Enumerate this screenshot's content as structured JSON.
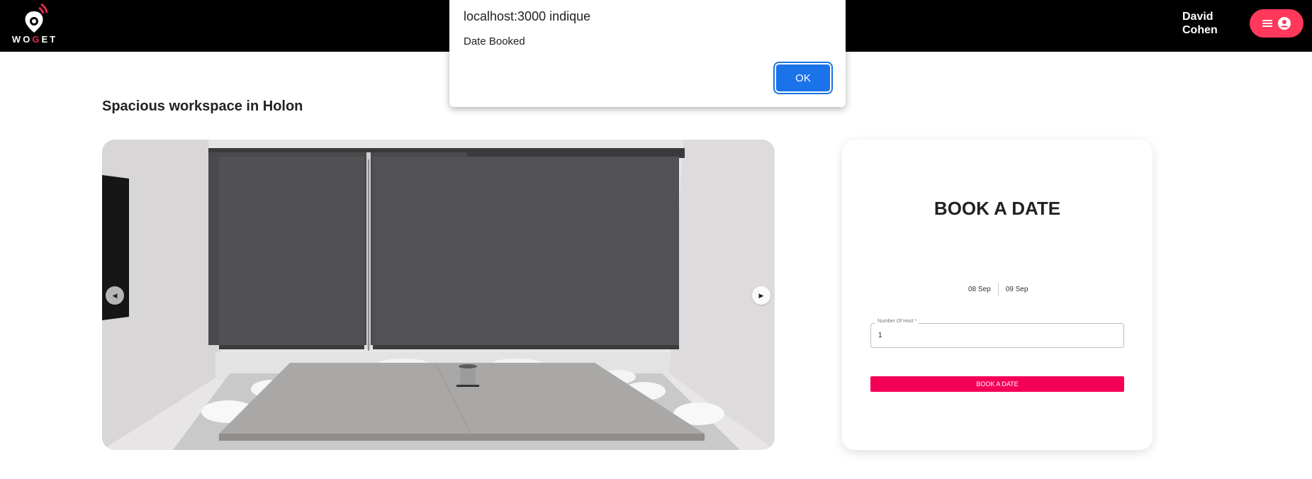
{
  "header": {
    "logo": {
      "text_prefix": "WO",
      "text_accent": "G",
      "text_suffix": "ET"
    },
    "user_first": "David",
    "user_last": "Cohen",
    "menu_icons": [
      "hamburger-icon",
      "user-circle-icon"
    ]
  },
  "listing": {
    "title": "Spacious workspace in Holon",
    "carousel": {
      "prev_icon": "chevron-left-icon",
      "next_icon": "chevron-right-icon"
    }
  },
  "booking": {
    "heading": "BOOK A DATE",
    "date_start": "08 Sep",
    "date_end": "09 Sep",
    "guests_label": "Number Of Host *",
    "guests_value": "1",
    "button_label": "BOOK A DATE"
  },
  "alert": {
    "title": "localhost:3000 indique",
    "message": "Date Booked",
    "ok_label": "OK"
  },
  "colors": {
    "accent": "#ff385c",
    "book_button": "#f50057",
    "dialog_button": "#1a73e8"
  }
}
